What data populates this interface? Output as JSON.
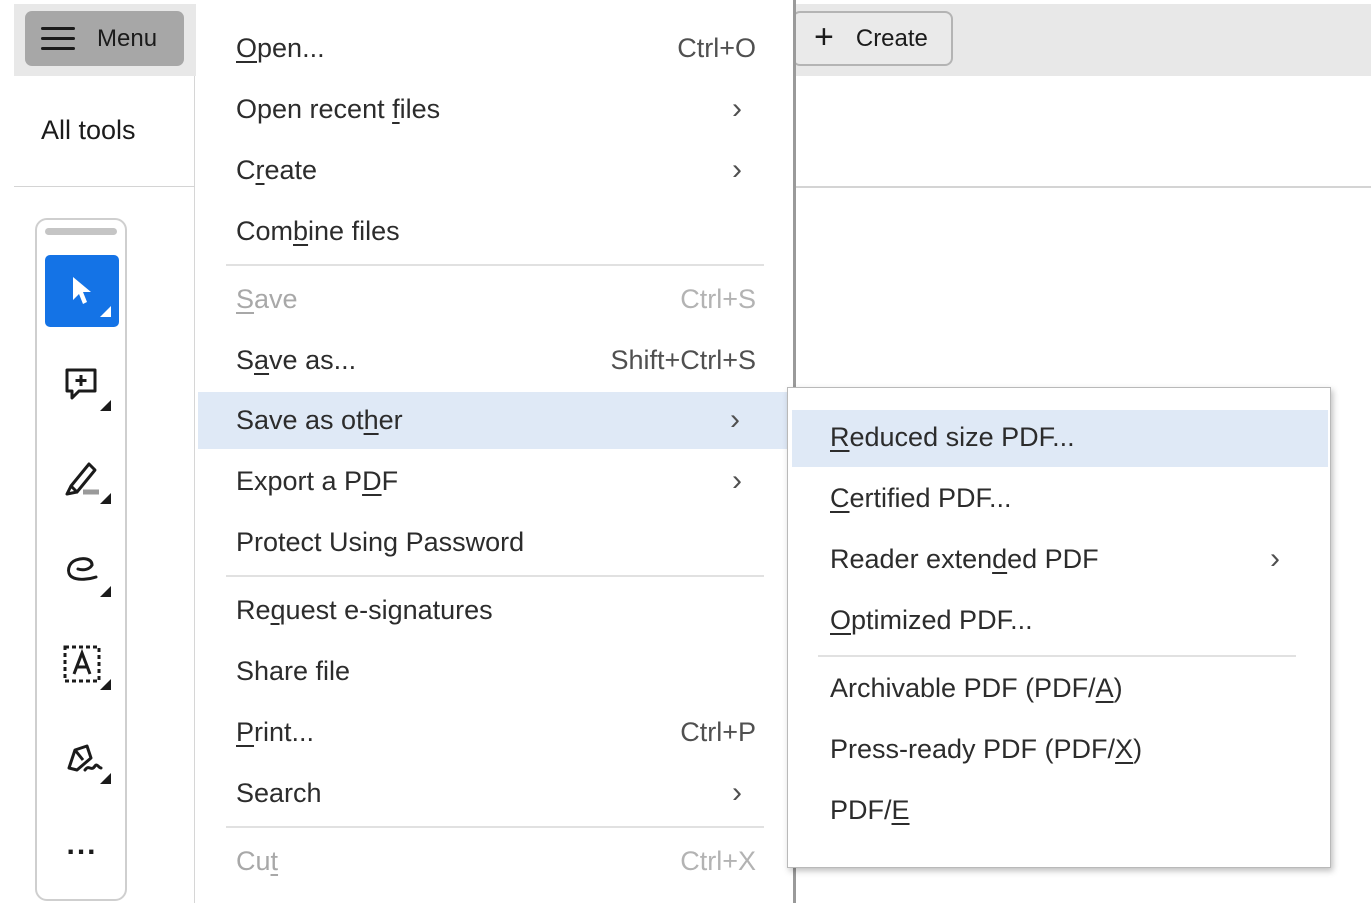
{
  "toolbar": {
    "menu_label": "Menu",
    "create_label": "Create"
  },
  "left_panel": {
    "title": "All tools",
    "tools": [
      {
        "icon": "select-arrow-icon",
        "active": true
      },
      {
        "icon": "add-comment-icon",
        "active": false
      },
      {
        "icon": "highlighter-icon",
        "active": false
      },
      {
        "icon": "draw-freeform-icon",
        "active": false
      },
      {
        "icon": "text-box-icon",
        "active": false
      },
      {
        "icon": "fill-sign-icon",
        "active": false
      },
      {
        "icon": "more-tools-icon",
        "active": false
      }
    ]
  },
  "main_menu": {
    "items": [
      {
        "label_pre": "",
        "mnemonic": "O",
        "label_post": "pen...",
        "shortcut": "Ctrl+O",
        "submenu": false,
        "disabled": false
      },
      {
        "label_pre": "Open recent ",
        "mnemonic": "f",
        "label_post": "iles",
        "shortcut": "",
        "submenu": true,
        "disabled": false
      },
      {
        "label_pre": "C",
        "mnemonic": "r",
        "label_post": "eate",
        "shortcut": "",
        "submenu": true,
        "disabled": false
      },
      {
        "label_pre": "Com",
        "mnemonic": "b",
        "label_post": "ine files",
        "shortcut": "",
        "submenu": false,
        "disabled": false
      },
      {
        "label_pre": "",
        "mnemonic": "S",
        "label_post": "ave",
        "shortcut": "Ctrl+S",
        "submenu": false,
        "disabled": true
      },
      {
        "label_pre": "S",
        "mnemonic": "a",
        "label_post": "ve as...",
        "shortcut": "Shift+Ctrl+S",
        "submenu": false,
        "disabled": false
      },
      {
        "label_pre": "Save as ot",
        "mnemonic": "h",
        "label_post": "er",
        "shortcut": "",
        "submenu": true,
        "disabled": false,
        "highlight": true
      },
      {
        "label_pre": "Export a P",
        "mnemonic": "D",
        "label_post": "F",
        "shortcut": "",
        "submenu": true,
        "disabled": false
      },
      {
        "label_pre": "Protect Using Password",
        "mnemonic": "",
        "label_post": "",
        "shortcut": "",
        "submenu": false,
        "disabled": false
      },
      {
        "label_pre": "Re",
        "mnemonic": "q",
        "label_post": "uest e-signatures",
        "shortcut": "",
        "submenu": false,
        "disabled": false
      },
      {
        "label_pre": "Share file",
        "mnemonic": "",
        "label_post": "",
        "shortcut": "",
        "submenu": false,
        "disabled": false
      },
      {
        "label_pre": "",
        "mnemonic": "P",
        "label_post": "rint...",
        "shortcut": "Ctrl+P",
        "submenu": false,
        "disabled": false
      },
      {
        "label_pre": "Search",
        "mnemonic": "",
        "label_post": "",
        "shortcut": "",
        "submenu": true,
        "disabled": false
      },
      {
        "label_pre": "Cu",
        "mnemonic": "t",
        "label_post": "",
        "shortcut": "Ctrl+X",
        "submenu": false,
        "disabled": true
      }
    ]
  },
  "save_as_other_submenu": {
    "items": [
      {
        "label_pre": "",
        "mnemonic": "R",
        "label_post": "educed size PDF...",
        "submenu": false,
        "highlight": true
      },
      {
        "label_pre": "",
        "mnemonic": "C",
        "label_post": "ertified PDF...",
        "submenu": false
      },
      {
        "label_pre": "Reader exten",
        "mnemonic": "d",
        "label_post": "ed PDF",
        "submenu": true
      },
      {
        "label_pre": "",
        "mnemonic": "O",
        "label_post": "ptimized PDF...",
        "submenu": false
      },
      {
        "label_pre": "Archivable PDF (PDF/",
        "mnemonic": "A",
        "label_post": ")",
        "submenu": false
      },
      {
        "label_pre": "Press-ready PDF (PDF/",
        "mnemonic": "X",
        "label_post": ")",
        "submenu": false
      },
      {
        "label_pre": "PDF/",
        "mnemonic": "E",
        "label_post": "",
        "submenu": false
      }
    ]
  },
  "icons": {
    "chevron": "›",
    "plus": "+",
    "more": "..."
  },
  "colors": {
    "accent": "#1473e6",
    "highlight": "#dfe9f6",
    "menu_button": "#a7a7a7"
  }
}
